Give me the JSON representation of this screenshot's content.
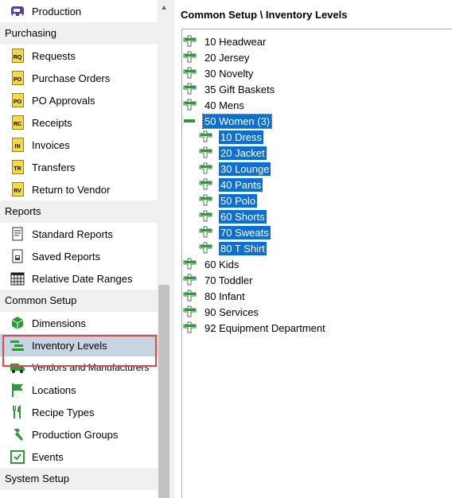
{
  "sidebar": {
    "items": [
      {
        "kind": "item",
        "label": "Production",
        "icon": "production-truck-icon"
      },
      {
        "kind": "section",
        "label": "Purchasing"
      },
      {
        "kind": "item",
        "label": "Requests",
        "icon": "requests-doc-icon",
        "code": "RQ"
      },
      {
        "kind": "item",
        "label": "Purchase Orders",
        "icon": "purchase-orders-doc-icon",
        "code": "PO"
      },
      {
        "kind": "item",
        "label": "PO Approvals",
        "icon": "po-approvals-doc-icon",
        "code": "PO"
      },
      {
        "kind": "item",
        "label": "Receipts",
        "icon": "receipts-doc-icon",
        "code": "RC"
      },
      {
        "kind": "item",
        "label": "Invoices",
        "icon": "invoices-doc-icon",
        "code": "IN"
      },
      {
        "kind": "item",
        "label": "Transfers",
        "icon": "transfers-doc-icon",
        "code": "TR"
      },
      {
        "kind": "item",
        "label": "Return to Vendor",
        "icon": "return-to-vendor-doc-icon",
        "code": "RV"
      },
      {
        "kind": "section",
        "label": "Reports"
      },
      {
        "kind": "item",
        "label": "Standard Reports",
        "icon": "standard-reports-icon"
      },
      {
        "kind": "item",
        "label": "Saved Reports",
        "icon": "saved-reports-icon"
      },
      {
        "kind": "item",
        "label": "Relative Date Ranges",
        "icon": "calendar-icon"
      },
      {
        "kind": "section",
        "label": "Common Setup"
      },
      {
        "kind": "item",
        "label": "Dimensions",
        "icon": "cube-icon"
      },
      {
        "kind": "item",
        "label": "Inventory Levels",
        "icon": "inventory-levels-icon",
        "selected": true
      },
      {
        "kind": "item",
        "label": "Vendors and Manufacturers",
        "icon": "truck-icon"
      },
      {
        "kind": "item",
        "label": "Locations",
        "icon": "flag-icon"
      },
      {
        "kind": "item",
        "label": "Recipe Types",
        "icon": "utensils-icon"
      },
      {
        "kind": "item",
        "label": "Production Groups",
        "icon": "hammer-icon"
      },
      {
        "kind": "item",
        "label": "Events",
        "icon": "calendar-check-icon"
      },
      {
        "kind": "section",
        "label": "System Setup"
      }
    ]
  },
  "main": {
    "title": "Common Setup \\ Inventory Levels",
    "tree": [
      {
        "label": "10   Headwear",
        "level": 0
      },
      {
        "label": "20   Jersey",
        "level": 0
      },
      {
        "label": "30   Novelty",
        "level": 0
      },
      {
        "label": "35   Gift Baskets",
        "level": 0
      },
      {
        "label": "40   Mens",
        "level": 0
      },
      {
        "label": "50   Women (3)",
        "level": 0,
        "expanded": true,
        "selected": true
      },
      {
        "label": "10   Dress",
        "level": 1
      },
      {
        "label": "20   Jacket",
        "level": 1
      },
      {
        "label": "30   Lounge",
        "level": 1
      },
      {
        "label": "40   Pants",
        "level": 1
      },
      {
        "label": "50   Polo",
        "level": 1
      },
      {
        "label": "60   Shorts",
        "level": 1
      },
      {
        "label": "70   Sweats",
        "level": 1
      },
      {
        "label": "80   T Shirt",
        "level": 1
      },
      {
        "label": "60   Kids",
        "level": 0
      },
      {
        "label": "70   Toddler",
        "level": 0
      },
      {
        "label": "80   Infant",
        "level": 0
      },
      {
        "label": "90   Services",
        "level": 0
      },
      {
        "label": "92   Equipment Department",
        "level": 0
      }
    ]
  },
  "colors": {
    "selection": "#0a70d4",
    "nav_selected": "#c7d4e2",
    "highlight_border": "#e04848",
    "section_bg": "#f0f0f0"
  }
}
